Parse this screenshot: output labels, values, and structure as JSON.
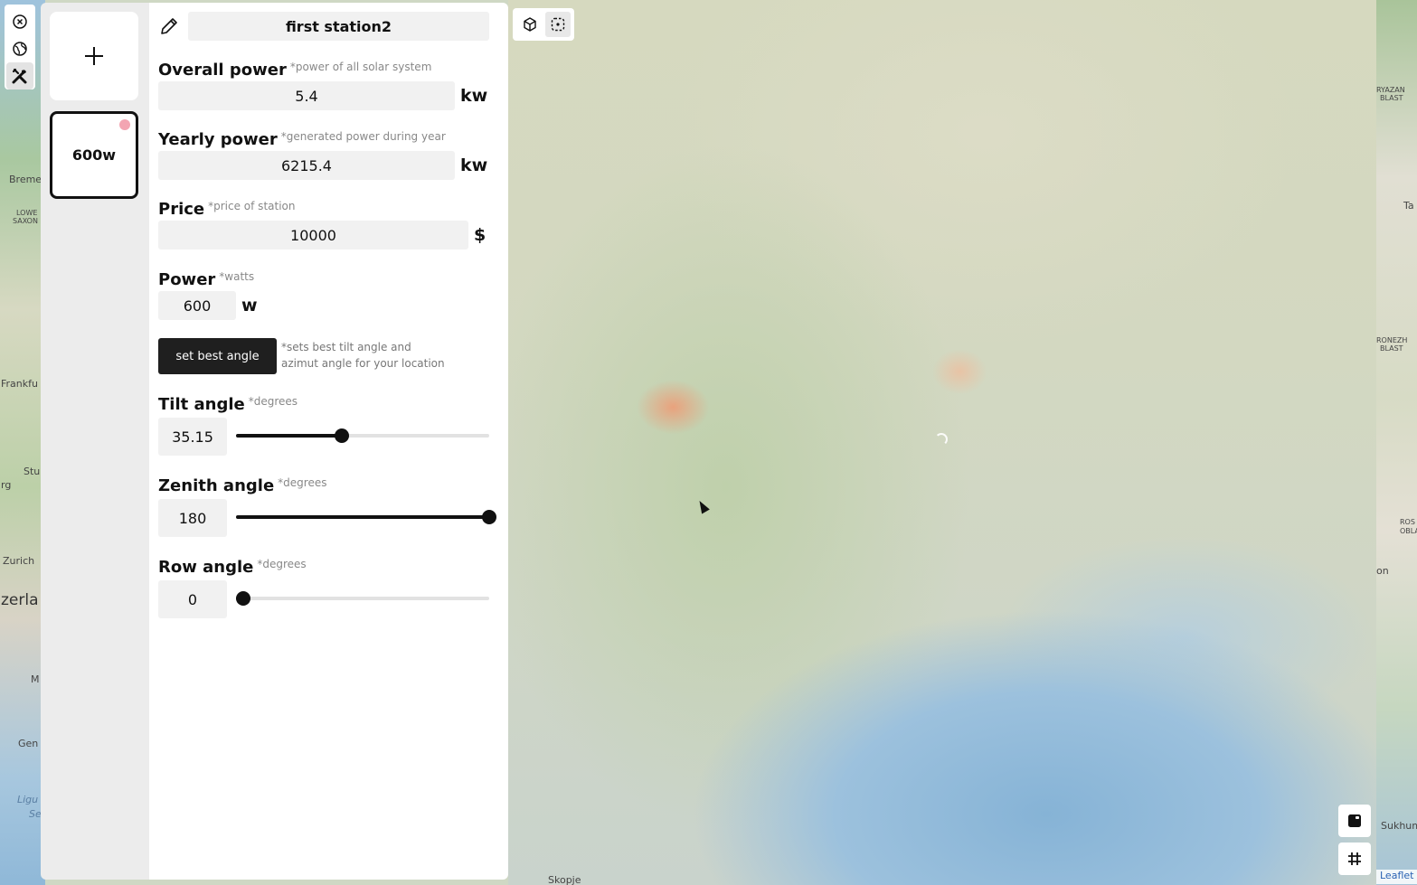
{
  "map": {
    "labels": {
      "bremen": "Breme",
      "lower_saxony_1": "LOWE",
      "lower_saxony_2": "SAXON",
      "frankfurt": "Frankfu",
      "stuttgart": "Stu",
      "burg": "rg",
      "zurich": "Zurich",
      "switzerland": "zerla",
      "m": "M",
      "geneva": "Gen",
      "ligurian_1": "Ligu",
      "ligurian_2": "Se",
      "ryazan_1": "RYAZAN",
      "ryazan_2": "BLAST",
      "ta": "Ta",
      "voronezh_1": "RONEZH",
      "voronezh_2": "BLAST",
      "rostov_1": "ROS",
      "rostov_2": "OBLA",
      "on": "on",
      "sukhumi": "Sukhum",
      "skopje": "Skopje"
    },
    "attribution": "Leaflet"
  },
  "rail": {
    "items": [
      {
        "name": "close-circle-icon",
        "active": false
      },
      {
        "name": "globe-icon",
        "active": false
      },
      {
        "name": "tools-icon",
        "active": true
      }
    ]
  },
  "stations": {
    "add_label": "+",
    "items": [
      {
        "label": "600w",
        "dot_color": "#f3a5b2"
      }
    ]
  },
  "panel": {
    "title": "first station2",
    "overall_power": {
      "label": "Overall power",
      "hint": "*power of all solar system",
      "value": "5.4",
      "unit": "kw"
    },
    "yearly_power": {
      "label": "Yearly power",
      "hint": "*generated power during year",
      "value": "6215.4",
      "unit": "kw"
    },
    "price": {
      "label": "Price",
      "hint": "*price of station",
      "value": "10000",
      "unit": "$"
    },
    "power": {
      "label": "Power",
      "hint": "*watts",
      "value": "600",
      "unit": "w"
    },
    "best_angle": {
      "label": "set best angle",
      "hint_line1": "*sets best tilt angle and",
      "hint_line2": "azimut angle for your location"
    },
    "tilt": {
      "label": "Tilt angle",
      "hint": "*degrees",
      "value": "35.15",
      "fraction": 0.4
    },
    "zenith": {
      "label": "Zenith angle",
      "hint": "*degrees",
      "value": "180",
      "fraction": 1.0
    },
    "row": {
      "label": "Row angle",
      "hint": "*degrees",
      "value": "0",
      "fraction": 0.0
    }
  },
  "map_controls": {
    "mode_buttons": [
      {
        "name": "cube-3d-icon",
        "active": false
      },
      {
        "name": "select-area-icon",
        "active": true
      }
    ],
    "corner_buttons": [
      {
        "name": "panel-toggle-icon"
      },
      {
        "name": "grid-icon"
      }
    ]
  },
  "colors": {
    "accent": "#111111",
    "panel_bg": "#ffffff",
    "input_bg": "#f1f1f1",
    "station_dot": "#f3a5b2",
    "button_dark": "#1f1f1f"
  }
}
